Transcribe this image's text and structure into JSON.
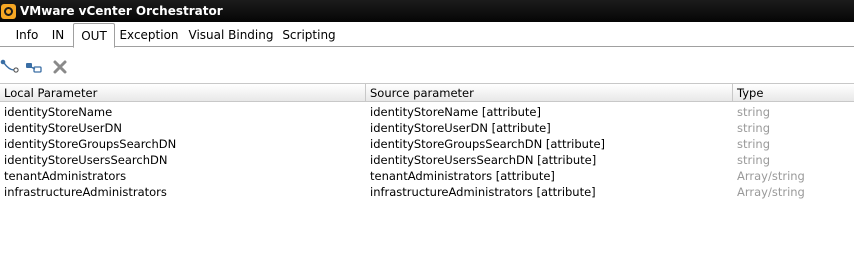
{
  "window": {
    "title": "VMware vCenter Orchestrator"
  },
  "tabs": [
    {
      "label": "Info"
    },
    {
      "label": "IN"
    },
    {
      "label": "OUT",
      "active": true
    },
    {
      "label": "Exception"
    },
    {
      "label": "Visual Binding"
    },
    {
      "label": "Scripting"
    }
  ],
  "toolbar": {
    "icons": [
      "bind-parameter-icon",
      "bind-attribute-icon",
      "delete-icon"
    ]
  },
  "table": {
    "columns": [
      "Local Parameter",
      "Source parameter",
      "Type"
    ],
    "rows": [
      {
        "local": "identityStoreName",
        "source": "identityStoreName [attribute]",
        "type": "string"
      },
      {
        "local": "identityStoreUserDN",
        "source": "identityStoreUserDN [attribute]",
        "type": "string"
      },
      {
        "local": "identityStoreGroupsSearchDN",
        "source": "identityStoreGroupsSearchDN [attribute]",
        "type": "string"
      },
      {
        "local": "identityStoreUsersSearchDN",
        "source": "identityStoreUsersSearchDN [attribute]",
        "type": "string"
      },
      {
        "local": "tenantAdministrators",
        "source": "tenantAdministrators [attribute]",
        "type": "Array/string"
      },
      {
        "local": "infrastructureAdministrators",
        "source": "infrastructureAdministrators [attribute]",
        "type": "Array/string"
      }
    ]
  },
  "colors": {
    "titlebar": "#0a0a0a",
    "logo": "#f5a623",
    "type_text": "#9a9a9a"
  }
}
